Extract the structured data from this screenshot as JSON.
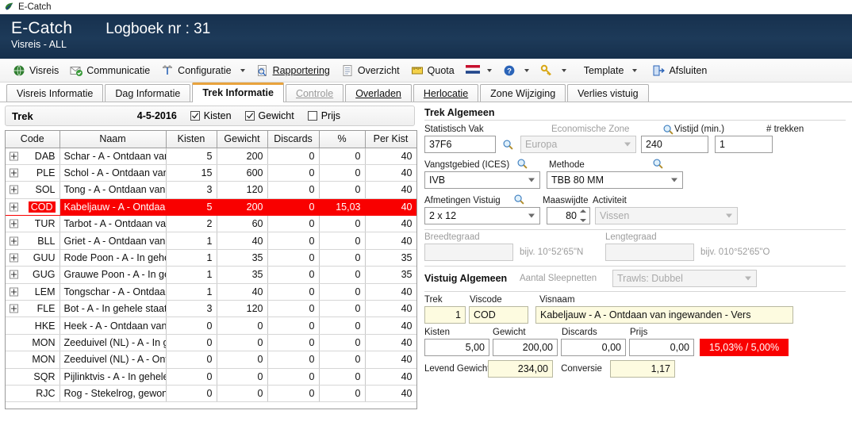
{
  "window": {
    "title": "E-Catch",
    "icon": "ecatch-logo-icon"
  },
  "header": {
    "app_name": "E-Catch",
    "logbook": "Logboek nr : 31",
    "subtitle": "Visreis - ALL",
    "bg_color": "#1b3451"
  },
  "toolbar": {
    "items": [
      {
        "label": "Visreis",
        "icon": "globe-icon",
        "caret": false
      },
      {
        "label": "Communicatie",
        "icon": "mail-send-icon",
        "caret": false
      },
      {
        "label": "Configuratie",
        "icon": "tools-icon",
        "caret": true
      },
      {
        "label": "Rapportering",
        "icon": "report-search-icon",
        "caret": false
      },
      {
        "label": "Overzicht",
        "icon": "document-icon",
        "caret": false
      },
      {
        "label": "Quota",
        "icon": "ruler-icon",
        "caret": false
      },
      {
        "label": "",
        "icon": "flag-nl-icon",
        "caret": true
      },
      {
        "label": "",
        "icon": "help-icon",
        "caret": true
      },
      {
        "label": "",
        "icon": "key-icon",
        "caret": true
      },
      {
        "label": "Template",
        "icon": "",
        "caret": true
      },
      {
        "label": "Afsluiten",
        "icon": "exit-icon",
        "caret": false
      }
    ]
  },
  "tabs": [
    {
      "label": "Visreis Informatie",
      "state": "normal"
    },
    {
      "label": "Dag Informatie",
      "state": "normal"
    },
    {
      "label": "Trek Informatie",
      "state": "active"
    },
    {
      "label": "Controle",
      "state": "disabled"
    },
    {
      "label": "Overladen",
      "state": "normal"
    },
    {
      "label": "Herlocatie",
      "state": "normal"
    },
    {
      "label": "Zone Wijziging",
      "state": "normal"
    },
    {
      "label": "Verlies vistuig",
      "state": "normal"
    }
  ],
  "trek_bar": {
    "title": "Trek",
    "date": "4-5-2016",
    "checkboxes": [
      {
        "label": "Kisten",
        "checked": true
      },
      {
        "label": "Gewicht",
        "checked": true
      },
      {
        "label": "Prijs",
        "checked": false
      }
    ]
  },
  "grid": {
    "columns": [
      "Code",
      "Naam",
      "Kisten",
      "Gewicht",
      "Discards",
      "%",
      "Per Kist"
    ],
    "selected_index": 3,
    "selected_color": "#f90000",
    "rows": [
      {
        "expander": true,
        "code": "DAB",
        "naam": "Schar - A - Ontdaan van",
        "kisten": "5",
        "gewicht": "200",
        "discards": "0",
        "pct": "0",
        "perkist": "40"
      },
      {
        "expander": true,
        "code": "PLE",
        "naam": "Schol - A - Ontdaan van i",
        "kisten": "15",
        "gewicht": "600",
        "discards": "0",
        "pct": "0",
        "perkist": "40"
      },
      {
        "expander": true,
        "code": "SOL",
        "naam": "Tong - A - Ontdaan van in",
        "kisten": "3",
        "gewicht": "120",
        "discards": "0",
        "pct": "0",
        "perkist": "40"
      },
      {
        "expander": true,
        "code": "COD",
        "naam": "Kabeljauw - A - Ontdaan",
        "kisten": "5",
        "gewicht": "200",
        "discards": "0",
        "pct": "15,03",
        "perkist": "40"
      },
      {
        "expander": true,
        "code": "TUR",
        "naam": "Tarbot - A - Ontdaan van",
        "kisten": "2",
        "gewicht": "60",
        "discards": "0",
        "pct": "0",
        "perkist": "40"
      },
      {
        "expander": true,
        "code": "BLL",
        "naam": "Griet - A - Ontdaan van in",
        "kisten": "1",
        "gewicht": "40",
        "discards": "0",
        "pct": "0",
        "perkist": "40"
      },
      {
        "expander": true,
        "code": "GUU",
        "naam": "Rode Poon - A - In gehele",
        "kisten": "1",
        "gewicht": "35",
        "discards": "0",
        "pct": "0",
        "perkist": "35"
      },
      {
        "expander": true,
        "code": "GUG",
        "naam": "Grauwe Poon - A - In geh",
        "kisten": "1",
        "gewicht": "35",
        "discards": "0",
        "pct": "0",
        "perkist": "35"
      },
      {
        "expander": true,
        "code": "LEM",
        "naam": "Tongschar - A - Ontdaan",
        "kisten": "1",
        "gewicht": "40",
        "discards": "0",
        "pct": "0",
        "perkist": "40"
      },
      {
        "expander": true,
        "code": "FLE",
        "naam": "Bot - A - In gehele staat -",
        "kisten": "3",
        "gewicht": "120",
        "discards": "0",
        "pct": "0",
        "perkist": "40"
      },
      {
        "expander": false,
        "code": "HKE",
        "naam": "Heek - A - Ontdaan van in",
        "kisten": "0",
        "gewicht": "0",
        "discards": "0",
        "pct": "0",
        "perkist": "40"
      },
      {
        "expander": false,
        "code": "MON",
        "naam": "Zeeduivel (NL) - A - In ge",
        "kisten": "0",
        "gewicht": "0",
        "discards": "0",
        "pct": "0",
        "perkist": "40"
      },
      {
        "expander": false,
        "code": "MON",
        "naam": "Zeeduivel (NL) - A - Ontd",
        "kisten": "0",
        "gewicht": "0",
        "discards": "0",
        "pct": "0",
        "perkist": "40"
      },
      {
        "expander": false,
        "code": "SQR",
        "naam": "Pijlinktvis - A - In gehele",
        "kisten": "0",
        "gewicht": "0",
        "discards": "0",
        "pct": "0",
        "perkist": "40"
      },
      {
        "expander": false,
        "code": "RJC",
        "naam": "Rog - Stekelrog, gewone",
        "kisten": "0",
        "gewicht": "0",
        "discards": "0",
        "pct": "0",
        "perkist": "40"
      }
    ]
  },
  "trek_algemeen": {
    "title": "Trek Algemeen",
    "statistisch_vak": {
      "label": "Statistisch Vak",
      "value": "37F6",
      "has_search": true
    },
    "economische_zone": {
      "label": "Economische Zone",
      "value": "Europa",
      "disabled": true,
      "has_search": true
    },
    "vistijd": {
      "label": "Vistijd (min.)",
      "value": "240"
    },
    "trekken": {
      "label": "# trekken",
      "value": "1"
    },
    "vangstgebied": {
      "label": "Vangstgebied (ICES)",
      "value": "IVB",
      "has_search": true
    },
    "methode": {
      "label": "Methode",
      "value": "TBB 80 MM",
      "has_search": true
    },
    "afmetingen_vistuig": {
      "label": "Afmetingen Vistuig",
      "value": "2 x 12",
      "has_search": true
    },
    "maaswijdte": {
      "label": "Maaswijdte",
      "value": "80"
    },
    "activiteit": {
      "label": "Activiteit",
      "value": "Vissen",
      "disabled": true
    },
    "breedtegraad": {
      "label": "Breedtegraad",
      "value": "",
      "placeholder": "bijv. 10°52'65\"N",
      "disabled": true
    },
    "lengtegraad": {
      "label": "Lengtegraad",
      "value": "",
      "placeholder": "bijv. 010°52'65\"O",
      "disabled": true
    }
  },
  "vistuig_algemeen": {
    "title": "Vistuig Algemeen",
    "aantal_sleepnetten": {
      "label": "Aantal Sleepnetten",
      "value": "Trawls: Dubbel",
      "disabled": true
    }
  },
  "detail": {
    "trek": {
      "label": "Trek",
      "value": "1"
    },
    "viscode": {
      "label": "Viscode",
      "value": "COD"
    },
    "visnaam": {
      "label": "Visnaam",
      "value": "Kabeljauw - A - Ontdaan van ingewanden - Vers"
    },
    "kisten": {
      "label": "Kisten",
      "value": "5,00"
    },
    "gewicht": {
      "label": "Gewicht",
      "value": "200,00"
    },
    "discards": {
      "label": "Discards",
      "value": "0,00"
    },
    "prijs": {
      "label": "Prijs",
      "value": "0,00"
    },
    "badge": {
      "text": "15,03% / 5,00%",
      "color": "#f90000"
    },
    "levend_gewicht": {
      "label": "Levend Gewicht",
      "value": "234,00"
    },
    "conversie": {
      "label": "Conversie",
      "value": "1,17"
    }
  }
}
